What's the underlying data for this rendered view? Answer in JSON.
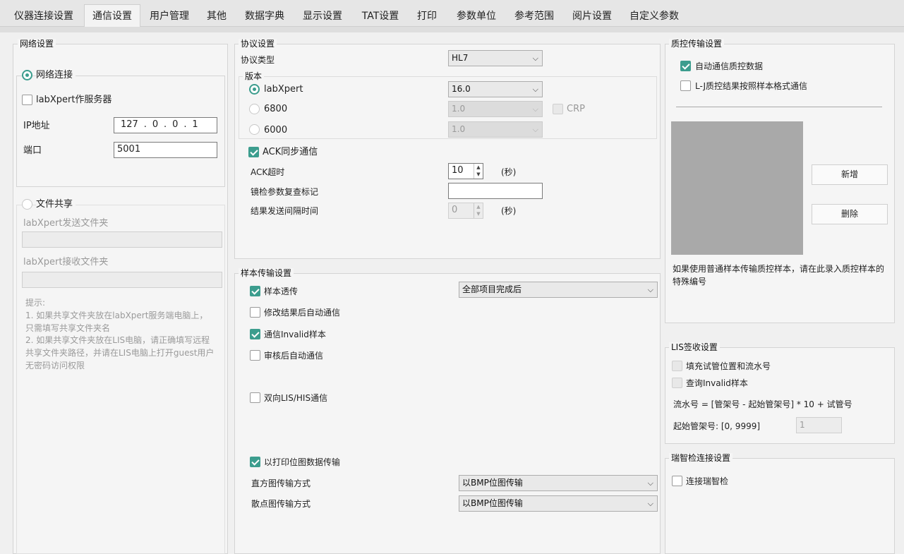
{
  "tabs": [
    "仪器连接设置",
    "通信设置",
    "用户管理",
    "其他",
    "数据字典",
    "显示设置",
    "TAT设置",
    "打印",
    "参数单位",
    "参考范围",
    "阅片设置",
    "自定义参数"
  ],
  "network": {
    "title": "网络设置",
    "net_connect_label": "网络连接",
    "server_label": "labXpert作服务器",
    "ip_label": "IP地址",
    "ip": [
      "127",
      "0",
      "0",
      "1"
    ],
    "port_label": "端口",
    "port_value": "5001",
    "file_share_label": "文件共享",
    "send_folder_label": "labXpert发送文件夹",
    "recv_folder_label": "labXpert接收文件夹",
    "hint_title": "提示:",
    "hint_1": "1. 如果共享文件夹放在labXpert服务端电脑上，\n只需填写共享文件夹名",
    "hint_2": "2. 如果共享文件夹放在LIS电脑，请正确填写远程\n共享文件夹路径，并请在LIS电脑上打开guest用户\n无密码访问权限"
  },
  "protocol": {
    "title": "协议设置",
    "type_label": "协议类型",
    "type_value": "HL7",
    "version_title": "版本",
    "versions": [
      {
        "label": "labXpert",
        "value": "16.0"
      },
      {
        "label": "6800",
        "value": "1.0"
      },
      {
        "label": "6000",
        "value": "1.0"
      }
    ],
    "crp_label": "CRP",
    "ack_sync_label": "ACK同步通信",
    "ack_timeout_label": "ACK超时",
    "ack_timeout_value": "10",
    "seconds_label": "(秒)",
    "mirror_label": "镜检参数复查标记",
    "resend_label": "结果发送间隔时间",
    "resend_value": "0",
    "seconds_label_2": "(秒)"
  },
  "sample": {
    "title": "样本传输设置",
    "passthrough_label": "样本透传",
    "passthrough_option": "全部项目完成后",
    "auto_after_modify_label": "修改结果后自动通信",
    "invalid_label": "通信Invalid样本",
    "auto_after_review_label": "审核后自动通信",
    "bidirectional_label": "双向LIS/HIS通信",
    "bitmap_label": "以打印位图数据传输",
    "histogram_label": "直方图传输方式",
    "histogram_value": "以BMP位图传输",
    "scatter_label": "散点图传输方式",
    "scatter_value": "以BMP位图传输"
  },
  "qc": {
    "title": "质控传输设置",
    "auto_qc_label": "自动通信质控数据",
    "lj_label": "L-J质控结果按照样本格式通信",
    "add_label": "新增",
    "delete_label": "删除",
    "note": "如果使用普通样本传输质控样本，请在此录入质控样本的特殊编号"
  },
  "lis": {
    "title": "LIS签收设置",
    "fill_label": "填充试管位置和流水号",
    "query_label": "查询Invalid样本",
    "formula": "流水号 = [管架号 - 起始管架号] * 10 + 试管号",
    "start_label": "起始管架号: [0, 9999]",
    "start_value": "1"
  },
  "smart": {
    "title": "瑞智检连接设置",
    "connect_label": "连接瑞智检"
  },
  "colors": {
    "accent": "#3c9d8e"
  }
}
